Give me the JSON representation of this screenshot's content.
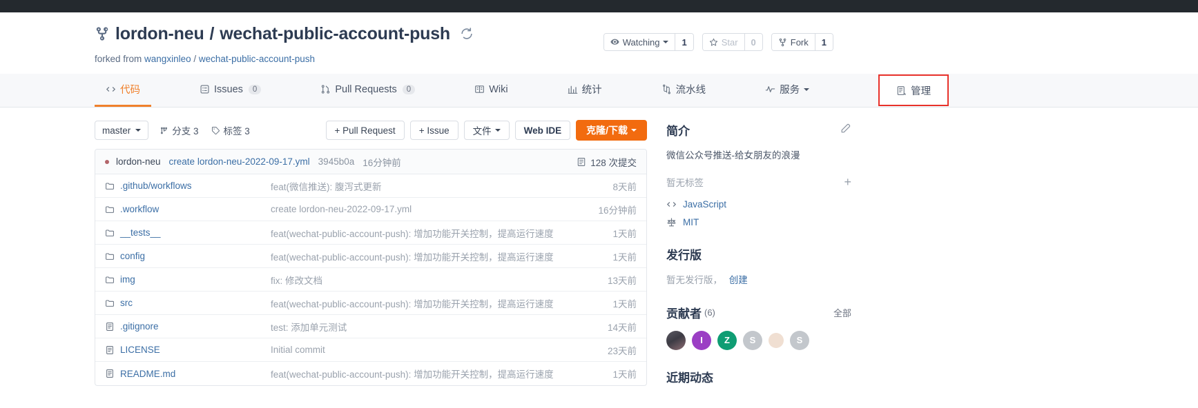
{
  "header": {
    "owner": "lordon-neu",
    "separator": "/",
    "repo": "wechat-public-account-push",
    "forked_prefix": "forked from",
    "forked_owner": "wangxinleo",
    "forked_sep": "/",
    "forked_repo": "wechat-public-account-push",
    "repo_icon": "repo-forked-icon",
    "sync_icon": "sync-icon"
  },
  "actions": {
    "watching": {
      "label": "Watching",
      "count": "1",
      "icon": "eye-icon"
    },
    "star": {
      "label": "Star",
      "count": "0",
      "icon": "star-icon"
    },
    "fork": {
      "label": "Fork",
      "count": "1",
      "icon": "fork-icon"
    }
  },
  "nav": {
    "tabs": [
      {
        "label": "代码",
        "icon": "code-icon",
        "count": null,
        "active": true
      },
      {
        "label": "Issues",
        "icon": "issue-icon",
        "count": "0",
        "active": false
      },
      {
        "label": "Pull Requests",
        "icon": "pull-request-icon",
        "count": "0",
        "active": false
      },
      {
        "label": "Wiki",
        "icon": "book-icon",
        "count": null,
        "active": false
      },
      {
        "label": "统计",
        "icon": "chart-icon",
        "count": null,
        "active": false
      },
      {
        "label": "流水线",
        "icon": "pipeline-icon",
        "count": null,
        "active": false
      },
      {
        "label": "服务",
        "icon": "activity-icon",
        "count": null,
        "active": false,
        "caret": true
      },
      {
        "label": "管理",
        "icon": "settings-icon",
        "count": null,
        "active": false,
        "highlight": true
      }
    ]
  },
  "toolbar": {
    "branch": "master",
    "branches_label": "分支 3",
    "tags_label": "标签 3",
    "pull_request": "+ Pull Request",
    "issue": "+ Issue",
    "files": "文件",
    "web_ide": "Web IDE",
    "clone": "克隆/下载"
  },
  "commit_bar": {
    "author": "lordon-neu",
    "message": "create lordon-neu-2022-09-17.yml",
    "sha": "3945b0a",
    "ago": "16分钟前",
    "commits": "128 次提交",
    "commits_icon": "history-icon"
  },
  "files": [
    {
      "name": ".github/workflows",
      "type": "dir",
      "message": "feat(微信推送): 腹泻式更新",
      "ago": "8天前"
    },
    {
      "name": ".workflow",
      "type": "dir",
      "message": "create lordon-neu-2022-09-17.yml",
      "ago": "16分钟前"
    },
    {
      "name": "__tests__",
      "type": "dir",
      "message": "feat(wechat-public-account-push): 增加功能开关控制，提高运行速度",
      "ago": "1天前"
    },
    {
      "name": "config",
      "type": "dir",
      "message": "feat(wechat-public-account-push): 增加功能开关控制，提高运行速度",
      "ago": "1天前"
    },
    {
      "name": "img",
      "type": "dir",
      "message": "fix: 修改文档",
      "ago": "13天前"
    },
    {
      "name": "src",
      "type": "dir",
      "message": "feat(wechat-public-account-push): 增加功能开关控制，提高运行速度",
      "ago": "1天前"
    },
    {
      "name": ".gitignore",
      "type": "file",
      "message": "test: 添加单元测试",
      "ago": "14天前"
    },
    {
      "name": "LICENSE",
      "type": "file",
      "message": "Initial commit",
      "ago": "23天前"
    },
    {
      "name": "README.md",
      "type": "file",
      "message": "feat(wechat-public-account-push): 增加功能开关控制，提高运行速度",
      "ago": "1天前"
    }
  ],
  "sidebar": {
    "about_title": "简介",
    "about_edit_icon": "edit-icon",
    "description": "微信公众号推送-给女朋友的浪漫",
    "no_tags": "暂无标签",
    "add_tag_icon": "plus-icon",
    "language": "JavaScript",
    "language_icon": "code-icon",
    "license": "MIT",
    "license_icon": "law-icon",
    "releases_title": "发行版",
    "no_releases": "暂无发行版，",
    "create_release": "创建",
    "contributors_title": "贡献者",
    "contributors_count": "(6)",
    "contributors_all": "全部",
    "contributors": [
      {
        "kind": "image",
        "label": ""
      },
      {
        "kind": "letter",
        "label": "I",
        "color": "#9b3fc4"
      },
      {
        "kind": "letter",
        "label": "Z",
        "color": "#0f9d73"
      },
      {
        "kind": "letter",
        "label": "S",
        "color": "#c3c7cc"
      },
      {
        "kind": "image-sm",
        "label": ""
      },
      {
        "kind": "letter",
        "label": "S",
        "color": "#c3c7cc"
      }
    ],
    "activity_title": "近期动态"
  },
  "colors": {
    "accent_orange": "#f0802b",
    "primary_button": "#f26b0f",
    "highlight_red": "#e8312a",
    "link_blue": "#3b6ea5"
  }
}
